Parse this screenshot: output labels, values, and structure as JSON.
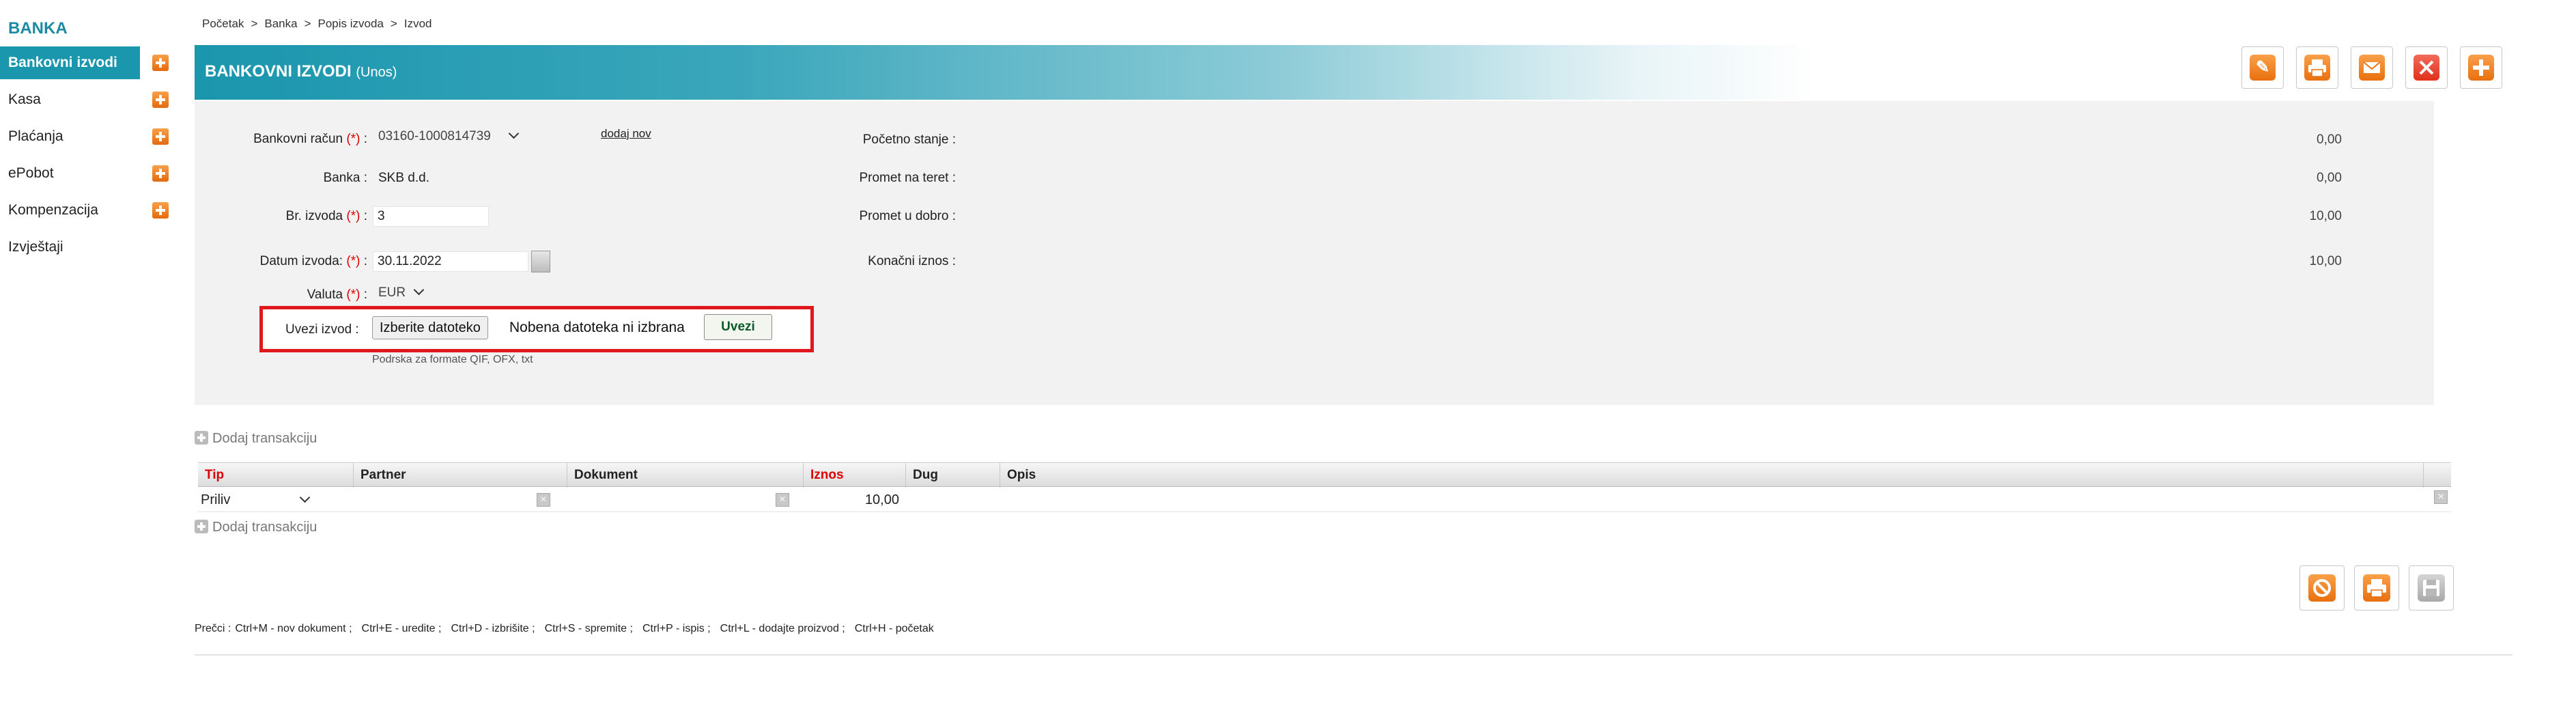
{
  "sidebar": {
    "title": "BANKA",
    "items": [
      {
        "label": "Bankovni izvodi",
        "active": true,
        "plus": true
      },
      {
        "label": "Kasa",
        "active": false,
        "plus": true
      },
      {
        "label": "Plaćanja",
        "active": false,
        "plus": true
      },
      {
        "label": "ePobot",
        "active": false,
        "plus": true
      },
      {
        "label": "Kompenzacija",
        "active": false,
        "plus": true
      },
      {
        "label": "Izvještaji",
        "active": false,
        "plus": false
      }
    ]
  },
  "breadcrumb": [
    "Početak",
    "Banka",
    "Popis izvoda",
    "Izvod"
  ],
  "breadcrumb_sep": ">",
  "header": {
    "title": "BANKOVNI IZVODI",
    "mode": "(Unos)",
    "toolbar_icons": [
      "edit-icon",
      "print-icon",
      "mail-icon",
      "delete-icon",
      "add-icon"
    ]
  },
  "form": {
    "required_mark": "(*)",
    "bank_account": {
      "label": "Bankovni račun",
      "value": "03160-1000814739",
      "add_link": "dodaj nov"
    },
    "bank": {
      "label": "Banka :",
      "value": "SKB d.d."
    },
    "statement_no": {
      "label": "Br. izvoda",
      "value": "3"
    },
    "statement_date": {
      "label": "Datum izvoda:",
      "value": "30.11.2022"
    },
    "currency": {
      "label": "Valuta",
      "value": "EUR"
    },
    "import": {
      "label": "Uvezi izvod :",
      "choose_file": "Izberite datoteko",
      "no_file": "Nobena datoteka ni izbrana",
      "import_button": "Uvezi",
      "support": "Podrska za formate QIF, OFX, txt"
    }
  },
  "summary": {
    "opening": {
      "label": "Početno stanje :",
      "value": "0,00"
    },
    "debit": {
      "label": "Promet na teret :",
      "value": "0,00"
    },
    "credit": {
      "label": "Promet u dobro :",
      "value": "10,00"
    },
    "final": {
      "label": "Konačni iznos :",
      "value": "10,00"
    }
  },
  "transactions": {
    "add_label": "Dodaj transakciju",
    "columns": [
      "Tip",
      "Partner",
      "Dokument",
      "Iznos",
      "Dug",
      "Opis"
    ],
    "rows": [
      {
        "tip": "Priliv",
        "partner": "",
        "dokument": "",
        "iznos": "10,00",
        "dug": "",
        "opis": ""
      }
    ]
  },
  "actions": [
    "cancel-icon",
    "print-icon",
    "save-icon"
  ],
  "shortcuts": {
    "prefix": "Prečci :",
    "items": [
      "Ctrl+M - nov dokument ;",
      "Ctrl+E - uredite ;",
      "Ctrl+D - izbrišite ;",
      "Ctrl+S - spremite ;",
      "Ctrl+P - ispis ;",
      "Ctrl+L - dodajte proizvod ;",
      "Ctrl+H - početak"
    ]
  },
  "colors": {
    "accent": "#1a96ad",
    "orange": "#f08a24",
    "red": "#e0171c"
  }
}
